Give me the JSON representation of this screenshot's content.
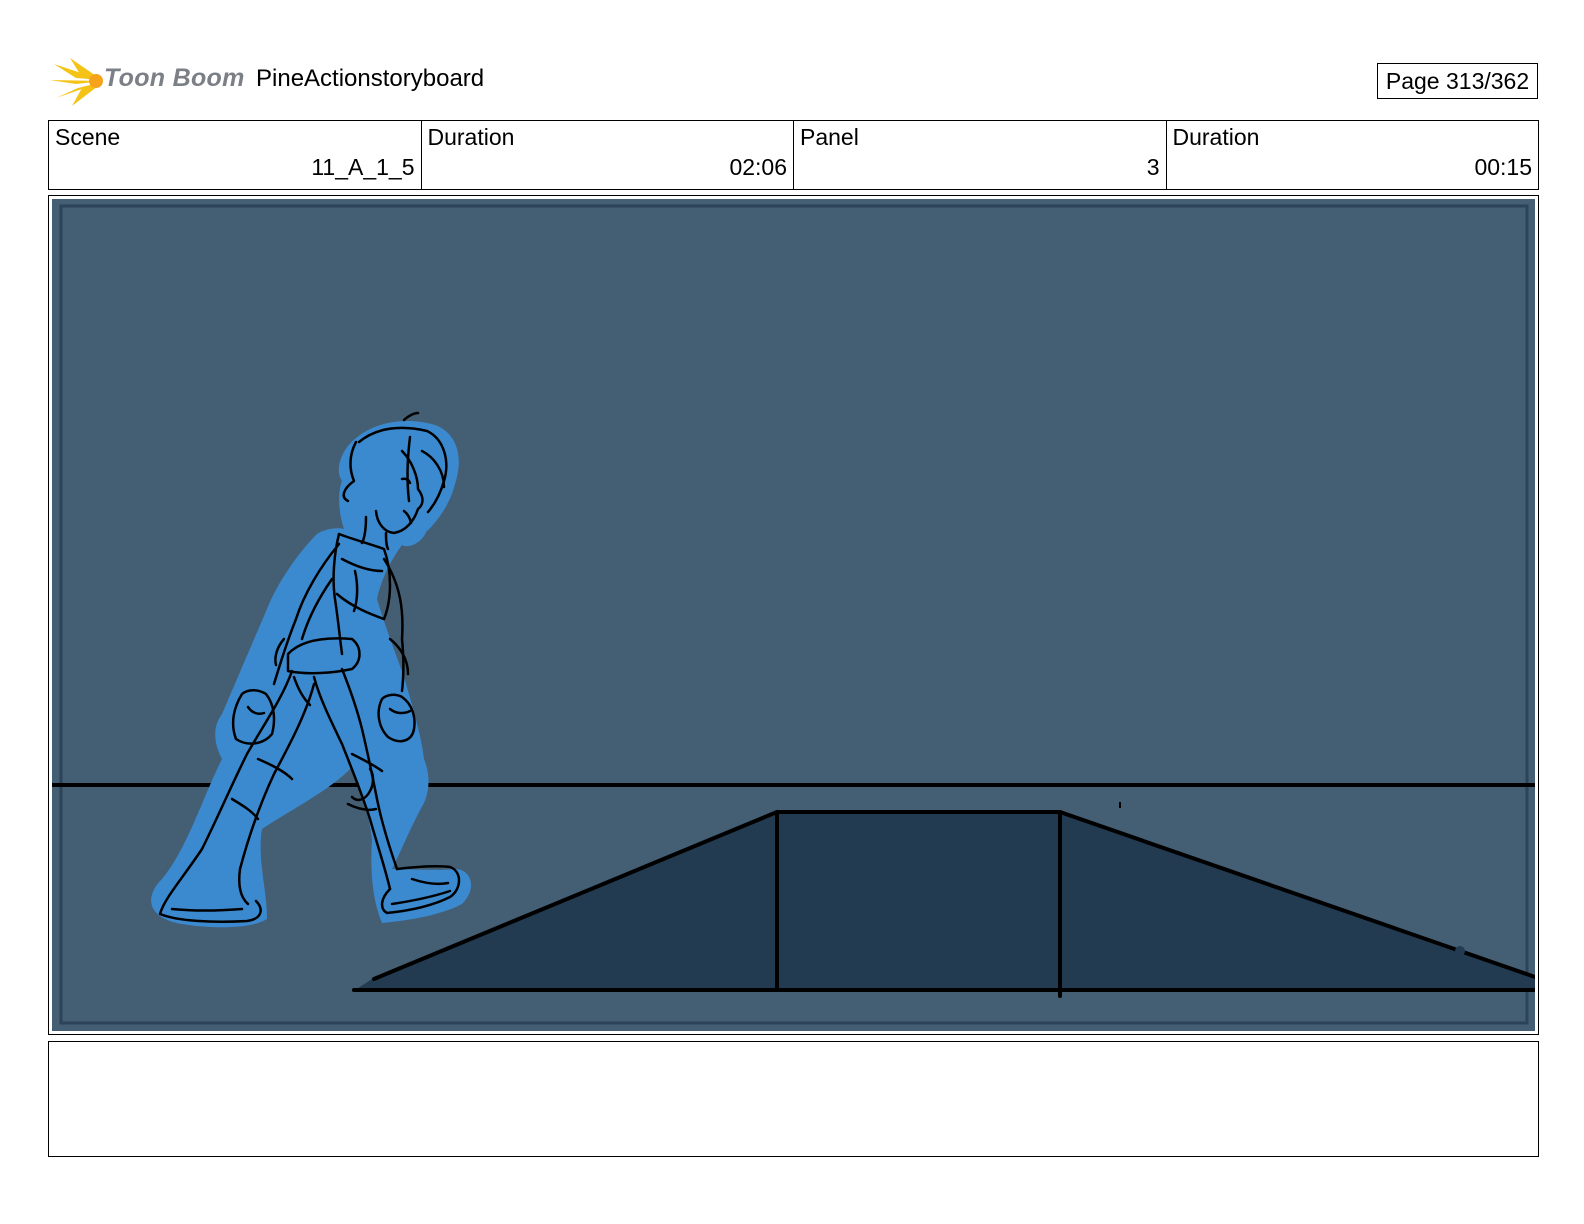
{
  "header": {
    "logo_text": "Toon Boom",
    "project_title": "PineActionstoryboard",
    "page_indicator": "Page 313/362"
  },
  "info": {
    "scene_label": "Scene",
    "scene_value": "11_A_1_5",
    "scene_duration_label": "Duration",
    "scene_duration_value": "02:06",
    "panel_label": "Panel",
    "panel_value": "3",
    "panel_duration_label": "Duration",
    "panel_duration_value": "00:15"
  },
  "notes": {
    "text": ""
  },
  "colors": {
    "background": "#445e74",
    "ramp": "#223b51",
    "character": "#3b8ad0",
    "line": "#000000",
    "logo_accent": "#f4c316"
  }
}
